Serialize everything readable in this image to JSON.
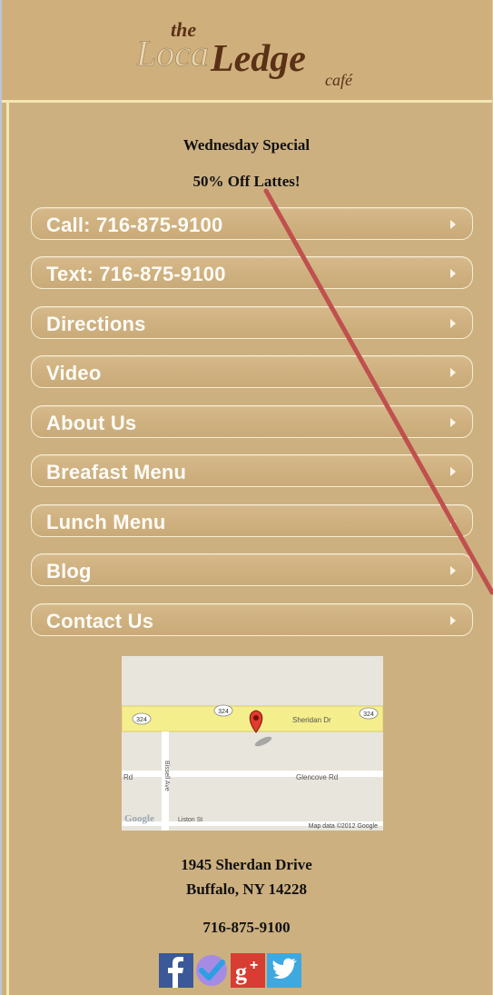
{
  "logo": {
    "the": "the",
    "loca": "Loca",
    "ledge": "Ledge",
    "cafe": "café"
  },
  "special": {
    "line1": "Wednesday Special",
    "line2": "50% Off Lattes!"
  },
  "nav": [
    {
      "label": "Call: 716-875-9100"
    },
    {
      "label": "Text: 716-875-9100"
    },
    {
      "label": "Directions"
    },
    {
      "label": "Video"
    },
    {
      "label": "About Us"
    },
    {
      "label": "Breafast Menu"
    },
    {
      "label": "Lunch Menu"
    },
    {
      "label": "Blog"
    },
    {
      "label": "Contact Us"
    }
  ],
  "map": {
    "road_sheridan": "Sheridan Dr",
    "road_glencove": "Glencove Rd",
    "road_rd": "Rd",
    "road_bissell": "Bissell Ave",
    "road_liston": "Liston St",
    "shield1": "324",
    "shield2": "324",
    "shield3": "324",
    "google": "Google",
    "attribution": "Map data ©2012 Google"
  },
  "address": {
    "line1": "1945 Sherdan Drive",
    "line2": "Buffalo, NY 14228",
    "phone": "716-875-9100"
  },
  "social_icons": [
    "facebook-icon",
    "foursquare-icon",
    "google-plus-icon",
    "twitter-icon"
  ],
  "colors": {
    "background": "#cdb080",
    "border_light": "#f3e6b3",
    "button_text": "#fdfbf6",
    "annotation_line": "#c0504d"
  }
}
